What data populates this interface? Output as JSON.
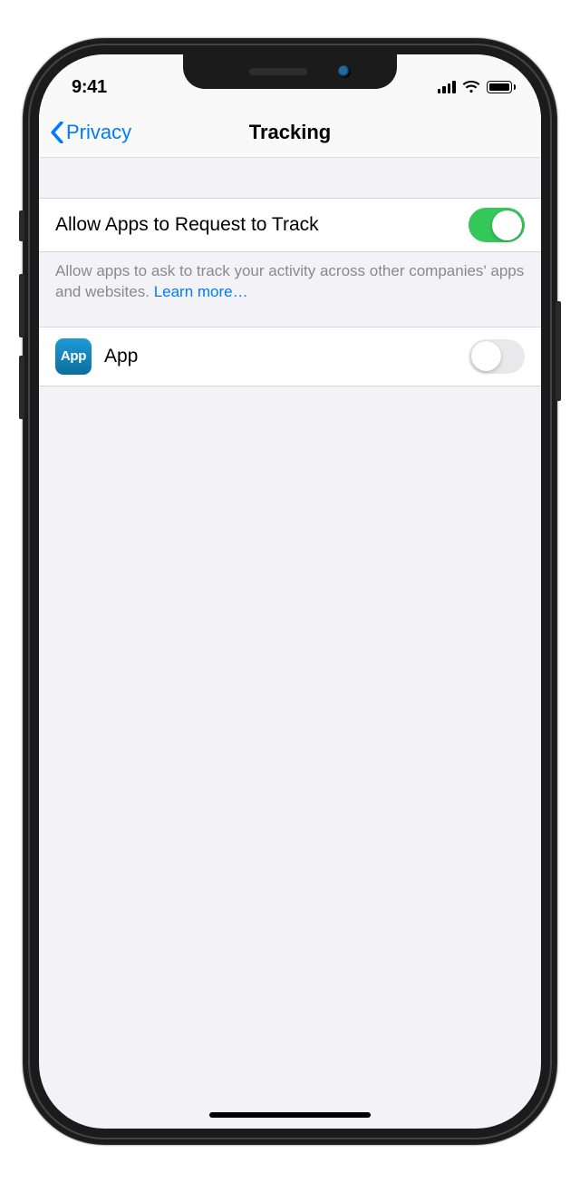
{
  "status": {
    "time": "9:41"
  },
  "nav": {
    "back_label": "Privacy",
    "title": "Tracking"
  },
  "main_toggle": {
    "label": "Allow Apps to Request to Track",
    "on": true
  },
  "description": {
    "text": "Allow apps to ask to track your activity across other companies' apps and websites. ",
    "link": "Learn more…"
  },
  "apps": [
    {
      "name": "App",
      "icon_text": "App",
      "tracking_on": false
    }
  ]
}
